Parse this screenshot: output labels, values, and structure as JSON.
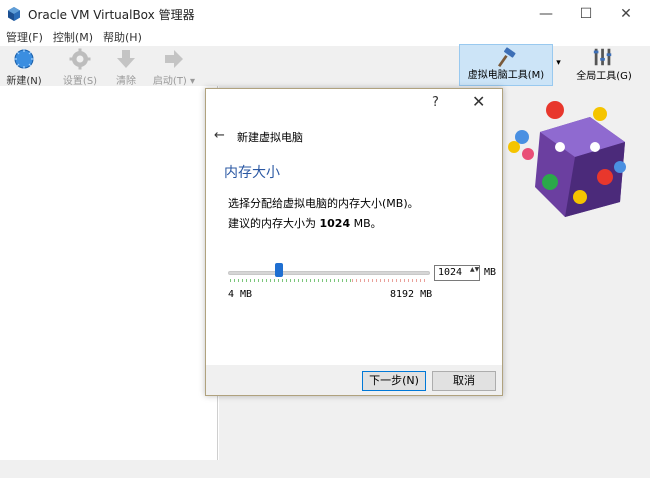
{
  "window": {
    "title": "Oracle VM VirtualBox 管理器",
    "controls": {
      "minimize": "—",
      "maximize": "☐",
      "close": "✕"
    }
  },
  "menu": [
    "管理(F)",
    "控制(M)",
    "帮助(H)"
  ],
  "toolbar": {
    "new": "新建(N)",
    "settings": "设置(S)",
    "clear": "清除",
    "start": "启动(T)",
    "start_arrow": "▾",
    "machine_tools": "虚拟电脑工具(M)",
    "machine_tools_arrow": "▾",
    "global_tools": "全局工具(G)"
  },
  "dialog": {
    "help": "?",
    "close": "✕",
    "back": "←",
    "wizard_title": "新建虚拟电脑",
    "page_title": "内存大小",
    "description": "选择分配给虚拟电脑的内存大小(MB)。",
    "recommend_prefix": "建议的内存大小为",
    "recommend_value": "1024",
    "recommend_unit": "MB。",
    "slider": {
      "value": 1024,
      "min": 4,
      "max": 8192
    },
    "min_label": "4 MB",
    "max_label": "8192 MB",
    "spin_value": "1024",
    "spin_arrows": "▲▼",
    "unit": "MB",
    "next_button": "下一步(N)",
    "cancel_button": "取消"
  },
  "colors": {
    "accent": "#2b58a3",
    "slider_thumb": "#1f6fd1",
    "recommended_range": "#7bc67b",
    "overcommit_range": "#e9a09a"
  }
}
